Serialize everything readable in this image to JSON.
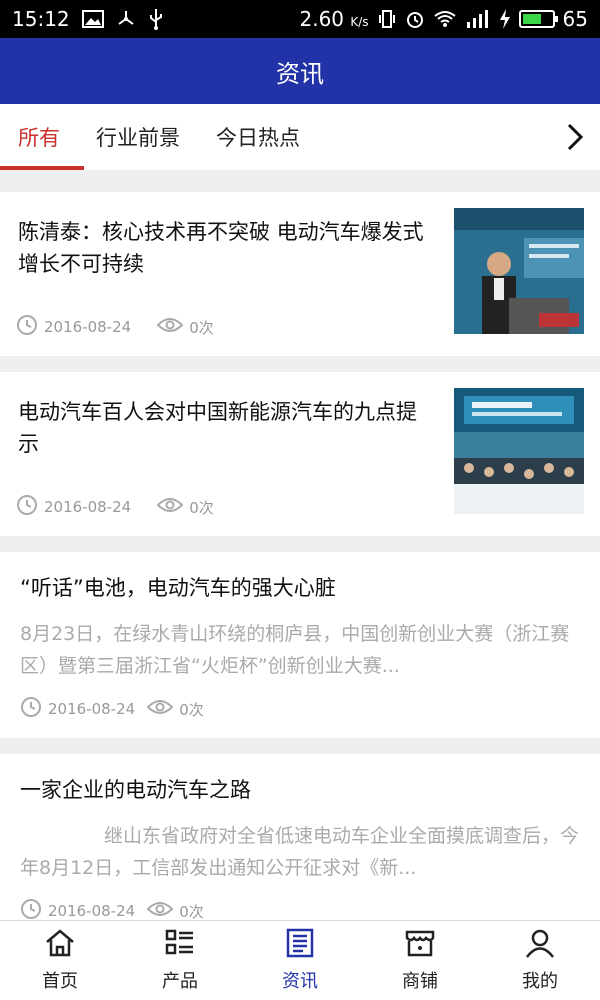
{
  "status_bar": {
    "time": "15:12",
    "network_speed": "2.60",
    "network_unit": "K/s",
    "battery_level": "65"
  },
  "header": {
    "title": "资讯"
  },
  "tabs": [
    {
      "label": "所有",
      "active": true
    },
    {
      "label": "行业前景",
      "active": false
    },
    {
      "label": "今日热点",
      "active": false
    }
  ],
  "articles": [
    {
      "title": "陈清泰：核心技术再不突破 电动汽车爆发式增长不可持续",
      "date": "2016-08-24",
      "views": "0次"
    },
    {
      "title": "电动汽车百人会对中国新能源汽车的九点提示",
      "date": "2016-08-24",
      "views": "0次"
    },
    {
      "title": "“听话”电池，电动汽车的强大心脏",
      "summary": "8月23日，在绿水青山环绕的桐庐县，中国创新创业大赛（浙江赛区）暨第三届浙江省“火炬杯”创新创业大赛...",
      "date": "2016-08-24",
      "views": "0次"
    },
    {
      "title": "一家企业的电动汽车之路",
      "summary": "继山东省政府对全省低速电动车企业全面摸底调查后，今年8月12日，工信部发出通知公开征求对《新...",
      "date": "2016-08-24",
      "views": "0次"
    }
  ],
  "bottom_nav": [
    {
      "label": "首页",
      "icon": "home-icon"
    },
    {
      "label": "产品",
      "icon": "list-icon"
    },
    {
      "label": "资讯",
      "icon": "news-icon",
      "active": true
    },
    {
      "label": "商铺",
      "icon": "store-icon"
    },
    {
      "label": "我的",
      "icon": "user-icon"
    }
  ],
  "colors": {
    "header_bg": "#2233a8",
    "tab_active": "#c9302c",
    "nav_active": "#2233a8"
  }
}
